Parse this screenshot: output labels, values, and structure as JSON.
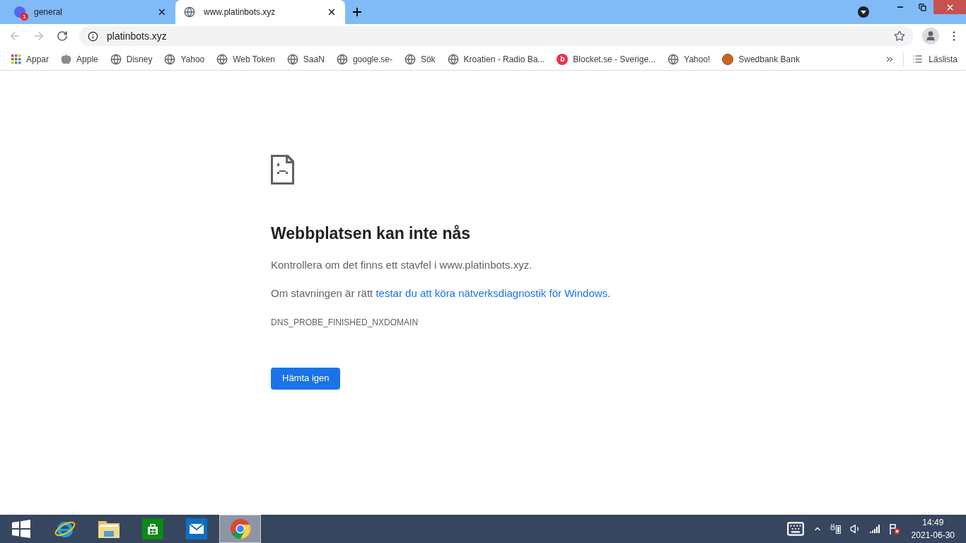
{
  "tabs": [
    {
      "title": "general",
      "kind": "app",
      "badge": "1",
      "selected": false
    },
    {
      "title": "www.platinbots.xyz",
      "kind": "globe",
      "selected": true
    }
  ],
  "address": {
    "url": "platinbots.xyz"
  },
  "bookmarks": [
    {
      "label": "Appar",
      "kind": "apps"
    },
    {
      "label": "Apple",
      "kind": "apple"
    },
    {
      "label": "Disney",
      "kind": "globe"
    },
    {
      "label": "Yahoo",
      "kind": "globe"
    },
    {
      "label": "Web Token",
      "kind": "globe"
    },
    {
      "label": "SaaN",
      "kind": "globe"
    },
    {
      "label": "google.se-",
      "kind": "globe"
    },
    {
      "label": "Sök",
      "kind": "globe"
    },
    {
      "label": "Kroatien - Radio Ba...",
      "kind": "globe"
    },
    {
      "label": "Blocket.se - Sverige...",
      "kind": "blocket",
      "badge": "b"
    },
    {
      "label": "Yahoo!",
      "kind": "globe"
    },
    {
      "label": "Swedbank  Bank",
      "kind": "ball"
    }
  ],
  "reading_list": "Läslista",
  "error": {
    "title": "Webbplatsen kan inte nås",
    "line1": "Kontrollera om det finns ett stavfel i www.platinbots.xyz.",
    "line2_prefix": "Om stavningen är rätt ",
    "line2_link": "testar du att köra nätverksdiagnostik för Windows",
    "line2_suffix": ".",
    "code": "DNS_PROBE_FINISHED_NXDOMAIN",
    "button": "Hämta igen"
  },
  "taskbar": [
    {
      "kind": "start",
      "selected": false
    },
    {
      "kind": "ie",
      "selected": false
    },
    {
      "kind": "explorer",
      "selected": false
    },
    {
      "kind": "store",
      "selected": false
    },
    {
      "kind": "mail",
      "selected": false
    },
    {
      "kind": "chrome",
      "selected": true
    }
  ],
  "clock": {
    "time": "14:49",
    "date": "2021-06-30"
  }
}
